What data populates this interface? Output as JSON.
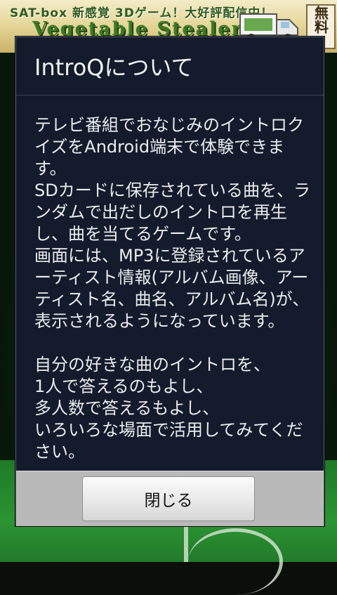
{
  "ad_banner": {
    "tagline": "SAT-box 新感覚 3Dゲーム！大好評配信中！",
    "title": "Vegetable Stealer",
    "side_text": "無料"
  },
  "dialog": {
    "title": "IntroQについて",
    "body": "テレビ番組でおなじみのイントロクイズをAndroid端末で体験できます。\nSDカードに保存されている曲を、ランダムで出だしのイントロを再生し、曲を当てるゲームです。\n画面には、MP3に登録されているアーティスト情報(アルバム画像、アーティスト名、曲名、アルバム名)が、表示されるようになっています。\n\n自分の好きな曲のイントロを、\n1人で答えるのもよし、\n多人数で答えるもよし、\nいろいろな場面で活用してみてください。",
    "close_label": "閉じる"
  },
  "colors": {
    "dialog_background": "#131b2c",
    "footer_background": "#b9b9b9",
    "field_green": "#2b9432"
  }
}
